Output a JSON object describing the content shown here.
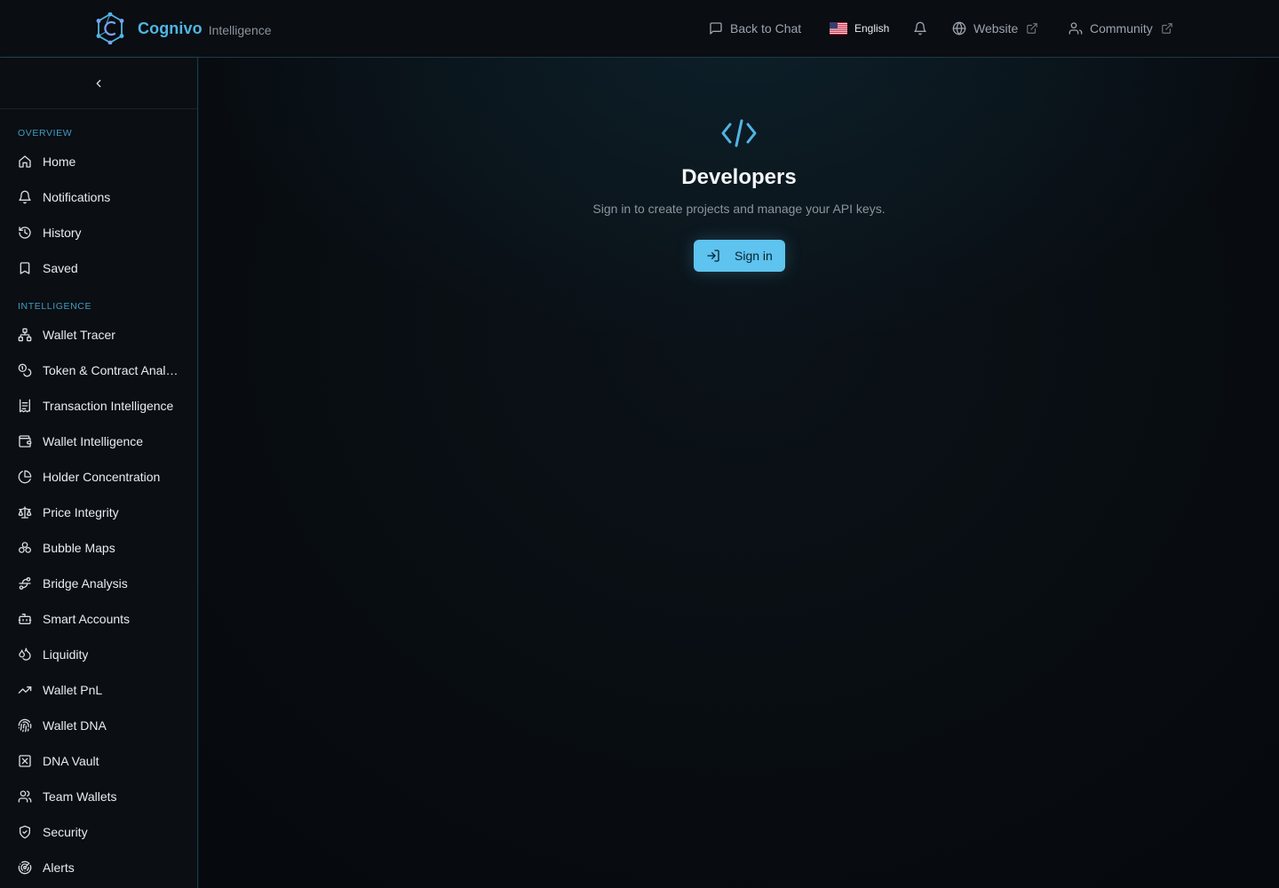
{
  "header": {
    "brand_name": "Cognivo",
    "brand_sub": "Intelligence",
    "back_to_chat": "Back to Chat",
    "language": "English",
    "website": "Website",
    "community": "Community"
  },
  "sidebar": {
    "sections": {
      "overview": "OVERVIEW",
      "intelligence": "INTELLIGENCE"
    },
    "overview_items": [
      {
        "label": "Home",
        "icon": "home-icon"
      },
      {
        "label": "Notifications",
        "icon": "bell-icon"
      },
      {
        "label": "History",
        "icon": "history-icon"
      },
      {
        "label": "Saved",
        "icon": "bookmark-icon"
      }
    ],
    "intelligence_items": [
      {
        "label": "Wallet Tracer",
        "icon": "network-icon"
      },
      {
        "label": "Token & Contract Analysis",
        "icon": "coins-icon"
      },
      {
        "label": "Transaction Intelligence",
        "icon": "receipt-icon"
      },
      {
        "label": "Wallet Intelligence",
        "icon": "wallet-icon"
      },
      {
        "label": "Holder Concentration",
        "icon": "pie-chart-icon"
      },
      {
        "label": "Price Integrity",
        "icon": "scale-icon"
      },
      {
        "label": "Bubble Maps",
        "icon": "bubbles-icon"
      },
      {
        "label": "Bridge Analysis",
        "icon": "bridge-icon"
      },
      {
        "label": "Smart Accounts",
        "icon": "bot-icon"
      },
      {
        "label": "Liquidity",
        "icon": "droplet-icon"
      },
      {
        "label": "Wallet PnL",
        "icon": "trending-up-icon"
      },
      {
        "label": "Wallet DNA",
        "icon": "fingerprint-icon"
      },
      {
        "label": "DNA Vault",
        "icon": "vault-icon"
      },
      {
        "label": "Team Wallets",
        "icon": "users-icon"
      },
      {
        "label": "Security",
        "icon": "shield-icon"
      },
      {
        "label": "Alerts",
        "icon": "radar-icon"
      }
    ]
  },
  "main": {
    "title": "Developers",
    "subtitle": "Sign in to create projects and manage your API keys.",
    "signin_label": "Sign in"
  },
  "colors": {
    "accent": "#4fb6e4",
    "button": "#5ec3ee",
    "background": "#06090d",
    "section_label": "#3f9cc4"
  }
}
